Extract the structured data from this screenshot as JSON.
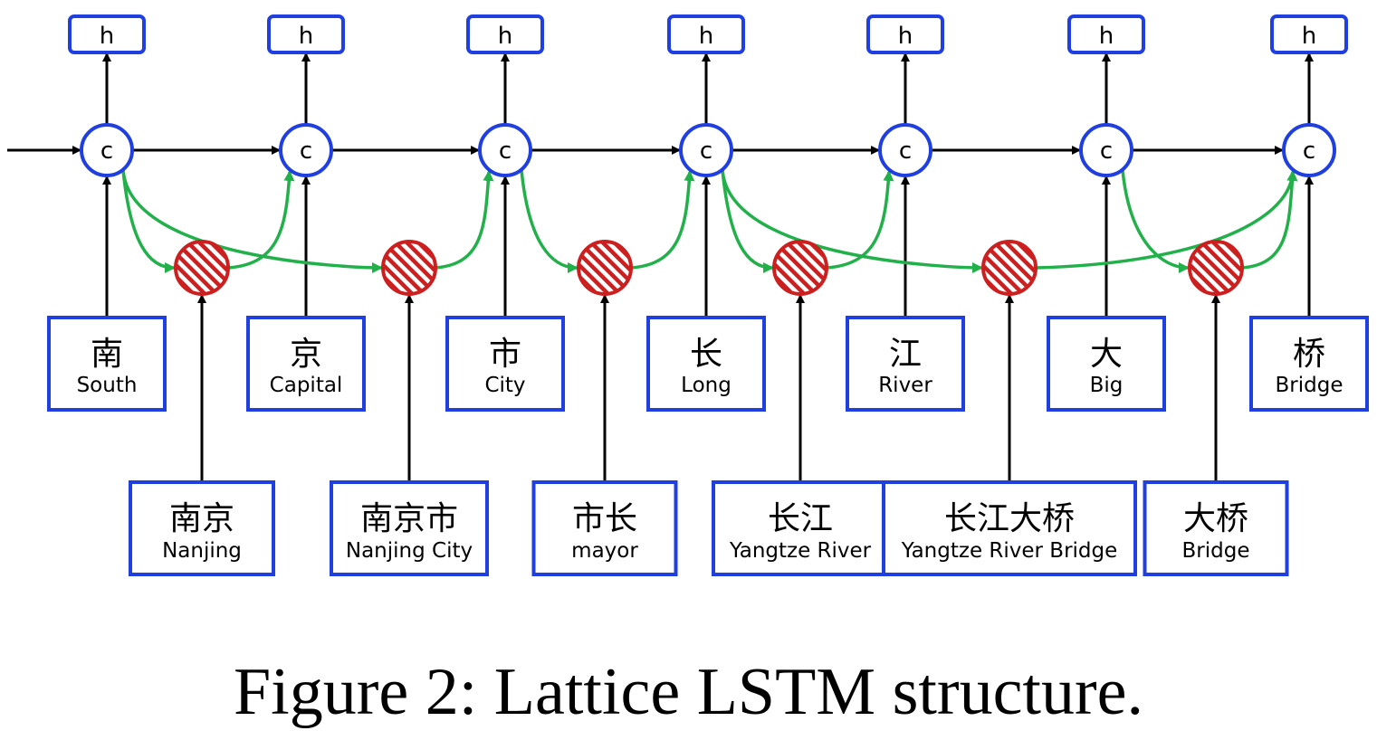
{
  "char_cells": [
    {
      "cell": "c",
      "hidden": "h",
      "char": "南",
      "gloss": "South"
    },
    {
      "cell": "c",
      "hidden": "h",
      "char": "京",
      "gloss": "Capital"
    },
    {
      "cell": "c",
      "hidden": "h",
      "char": "市",
      "gloss": "City"
    },
    {
      "cell": "c",
      "hidden": "h",
      "char": "长",
      "gloss": "Long"
    },
    {
      "cell": "c",
      "hidden": "h",
      "char": "江",
      "gloss": "River"
    },
    {
      "cell": "c",
      "hidden": "h",
      "char": "大",
      "gloss": "Big"
    },
    {
      "cell": "c",
      "hidden": "h",
      "char": "桥",
      "gloss": "Bridge"
    }
  ],
  "words": [
    {
      "word": "南京",
      "gloss": "Nanjing",
      "from": 0,
      "to": 1
    },
    {
      "word": "南京市",
      "gloss": "Nanjing City",
      "from": 0,
      "to": 2
    },
    {
      "word": "市长",
      "gloss": "mayor",
      "from": 2,
      "to": 3
    },
    {
      "word": "长江",
      "gloss": "Yangtze  River",
      "from": 3,
      "to": 4
    },
    {
      "word": "长江大桥",
      "gloss": "Yangtze  River Bridge",
      "from": 3,
      "to": 6
    },
    {
      "word": "大桥",
      "gloss": "Bridge",
      "from": 5,
      "to": 6
    }
  ],
  "colors": {
    "cell_border": "#1f3fe0",
    "word_cell_fill": "#cc1f1f",
    "lattice_edge": "#22b04b",
    "chain_edge": "#000000"
  },
  "caption": "Figure 2: Lattice LSTM structure."
}
